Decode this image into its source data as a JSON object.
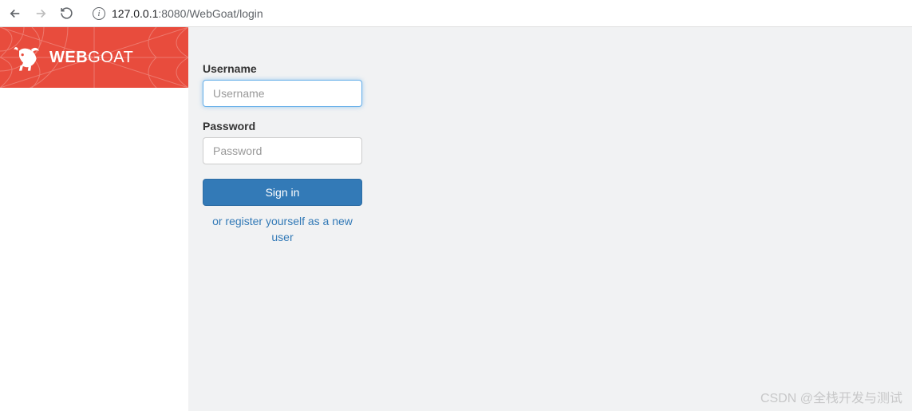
{
  "browser": {
    "url_host": "127.0.0.1",
    "url_port": ":8080",
    "url_path": "/WebGoat/login",
    "info_icon": "i"
  },
  "brand": {
    "name_bold": "WEB",
    "name_rest": "GOAT"
  },
  "form": {
    "username_label": "Username",
    "username_placeholder": "Username",
    "username_value": "",
    "password_label": "Password",
    "password_placeholder": "Password",
    "password_value": "",
    "signin_label": "Sign in",
    "register_text": "or register yourself as a new user"
  },
  "watermark": "CSDN @全栈开发与测试"
}
